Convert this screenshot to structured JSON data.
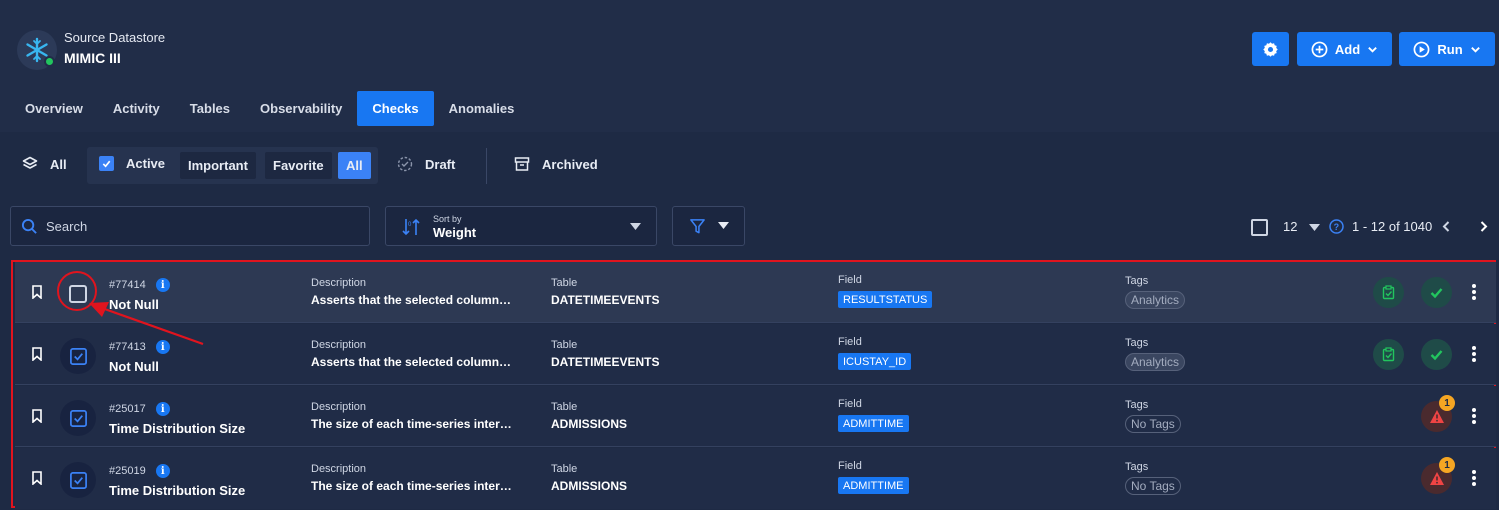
{
  "datastore": {
    "type_label": "Source Datastore",
    "name": "MIMIC III",
    "icon": "snowflake-icon",
    "status_color": "#22c55e"
  },
  "header_actions": {
    "settings_icon": "gear-icon",
    "add_label": "Add",
    "run_label": "Run"
  },
  "tabs": [
    {
      "label": "Overview",
      "active": false
    },
    {
      "label": "Activity",
      "active": false
    },
    {
      "label": "Tables",
      "active": false
    },
    {
      "label": "Observability",
      "active": false
    },
    {
      "label": "Checks",
      "active": true
    },
    {
      "label": "Anomalies",
      "active": false
    }
  ],
  "filters": {
    "all_label": "All",
    "active_label": "Active",
    "important_label": "Important",
    "favorite_label": "Favorite",
    "active_all_label": "All",
    "draft_label": "Draft",
    "archived_label": "Archived"
  },
  "search": {
    "placeholder": "Search"
  },
  "sort": {
    "label": "Sort by",
    "value": "Weight"
  },
  "pagination": {
    "page_size": "12",
    "range": "1 - 12 of 1040"
  },
  "columns": {
    "description": "Description",
    "table": "Table",
    "field": "Field",
    "tags": "Tags"
  },
  "checks": [
    {
      "id": "#77414",
      "name": "Not Null",
      "description": "Asserts that the selected column…",
      "table": "DATETIMEEVENTS",
      "field": "RESULTSTATUS",
      "tag": "Analytics",
      "selected": false,
      "status": "passed"
    },
    {
      "id": "#77413",
      "name": "Not Null",
      "description": "Asserts that the selected column…",
      "table": "DATETIMEEVENTS",
      "field": "ICUSTAY_ID",
      "tag": "Analytics",
      "selected": true,
      "status": "passed"
    },
    {
      "id": "#25017",
      "name": "Time Distribution Size",
      "description": "The size of each time-series inter…",
      "table": "ADMISSIONS",
      "field": "ADMITTIME",
      "tag": "No Tags",
      "selected": true,
      "status": "anomaly",
      "anomaly_count": "1"
    },
    {
      "id": "#25019",
      "name": "Time Distribution Size",
      "description": "The size of each time-series inter…",
      "table": "ADMISSIONS",
      "field": "ADMITTIME",
      "tag": "No Tags",
      "selected": true,
      "status": "anomaly",
      "anomaly_count": "1"
    }
  ],
  "colors": {
    "accent": "#1877f2",
    "annotation": "#e0141e",
    "passed": "#22c55e",
    "anomaly": "#f5a623"
  }
}
